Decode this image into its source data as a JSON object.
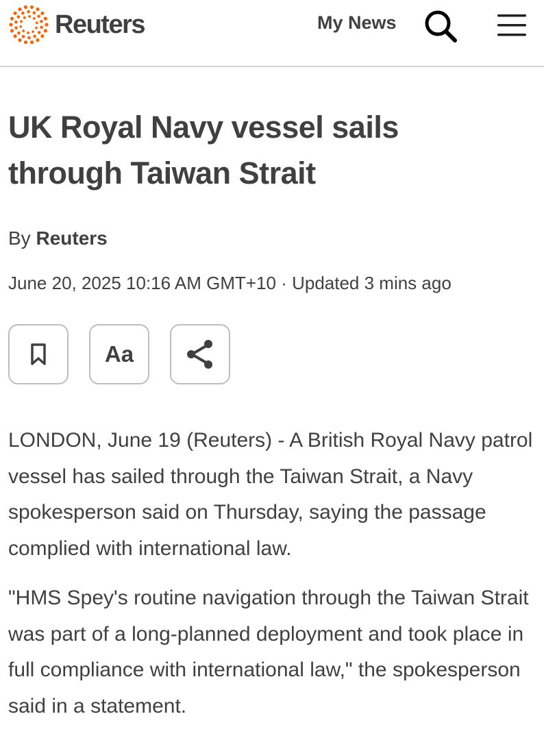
{
  "header": {
    "logo_text": "Reuters",
    "my_news_label": "My News",
    "search_icon": "search-icon",
    "menu_icon": "hamburger-menu-icon",
    "brand_color": "#fa6400"
  },
  "article": {
    "headline": "UK Royal Navy vessel sails through Taiwan Strait",
    "byline_prefix": "By",
    "byline_author": "Reuters",
    "dateline": "June 20, 2025 10:16 AM GMT+10 · Updated 3 mins ago",
    "tools": {
      "bookmark_icon": "bookmark-icon",
      "font_size_label": "Aa",
      "share_icon": "share-icon"
    },
    "paragraphs": [
      "LONDON, June 19 (Reuters) - A British Royal Navy patrol vessel has sailed through the Taiwan Strait, a Navy spokesperson said on Thursday, saying the passage complied with international law.",
      "\"HMS Spey's routine navigation through the Taiwan Strait was part of a long-planned deployment and took place in full compliance with international law,\" the spokesperson said in a statement."
    ]
  }
}
